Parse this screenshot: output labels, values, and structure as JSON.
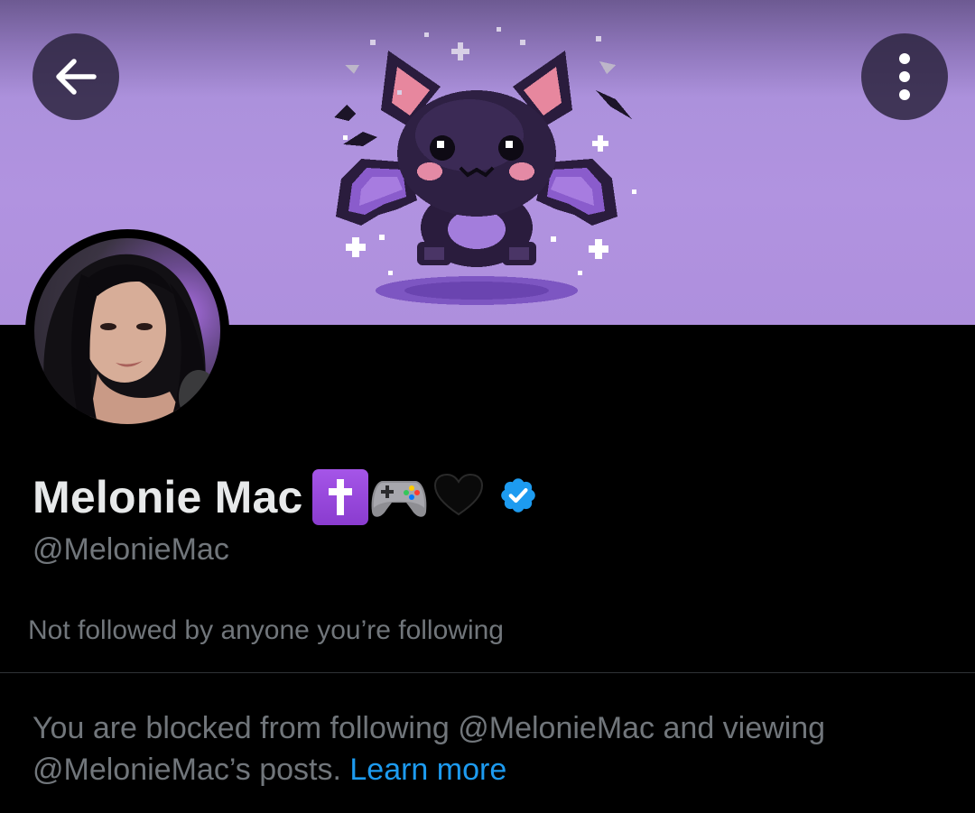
{
  "header": {
    "back_icon": "arrow-left-icon",
    "more_icon": "more-vertical-icon",
    "banner_art": "pixel-bat-illustration"
  },
  "profile": {
    "display_name": "Melonie Mac",
    "name_emojis": [
      "latin-cross-emoji",
      "video-game-controller-emoji",
      "black-heart-emoji"
    ],
    "verified": true,
    "handle": "@MelonieMac",
    "followed_by_text": "Not followed by anyone you’re following"
  },
  "blocked": {
    "message": "You are blocked from following @MelonieMac and viewing @MelonieMac’s posts.",
    "learn_more_label": "Learn more"
  },
  "colors": {
    "background": "#000000",
    "text_primary": "#e7e9ea",
    "text_secondary": "#71767b",
    "link": "#1d9bf0",
    "verified": "#1d9bf0",
    "banner_purple": "#b193e0"
  }
}
